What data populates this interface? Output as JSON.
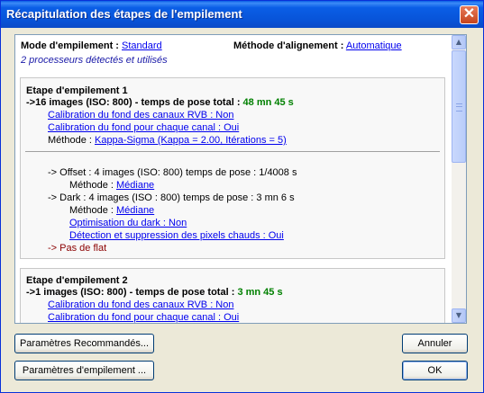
{
  "window": {
    "title": "Récapitulation des étapes de l'empilement",
    "close_glyph": "✕"
  },
  "header": {
    "mode_label": "Mode d'empilement :",
    "mode_value": "Standard",
    "align_label": "Méthode d'alignement :",
    "align_value": "Automatique",
    "cpu_text": "2 processeurs détectés et utilisés"
  },
  "step1": {
    "title": "Etape d'empilement 1",
    "summary": "->16 images (ISO: 800) - temps de pose total :",
    "total": "48 mn 45 s",
    "rgb_calib": "Calibration du fond des canaux RVB : Non",
    "channel_calib": "Calibration du fond pour chaque canal : Oui",
    "method_label": "Méthode :",
    "method_value": "Kappa-Sigma (Kappa = 2.00, Itérations = 5)",
    "offset_line": "-> Offset : 4 images (ISO: 800) temps de pose : 1/4008 s",
    "offset_method_label": "Méthode :",
    "offset_method_value": "Médiane",
    "dark_line": "-> Dark : 4 images (ISO : 800) temps de pose : 3 mn 6 s",
    "dark_method_label": "Méthode :",
    "dark_method_value": "Médiane",
    "dark_optim": "Optimisation du dark : Non",
    "hot_pixels": "Détection et suppression des pixels chauds : Oui",
    "no_flat": "-> Pas de flat"
  },
  "step2": {
    "title": "Etape d'empilement 2",
    "summary": "->1 images (ISO: 800) - temps de pose total :",
    "total": "3 mn 45 s",
    "rgb_calib": "Calibration du fond des canaux RVB : Non",
    "channel_calib": "Calibration du fond pour chaque canal : Oui"
  },
  "scrollbar": {
    "up_glyph": "▲",
    "down_glyph": "▼"
  },
  "buttons": {
    "recommended": "Paramètres Recommandés...",
    "stacking_params": "Paramètres d'empilement ...",
    "cancel": "Annuler",
    "ok": "OK"
  },
  "colors": {
    "link": "#0000ee",
    "total_time": "#008000",
    "no_flat": "#8b0000",
    "titlebar": "#0a5ee6"
  }
}
